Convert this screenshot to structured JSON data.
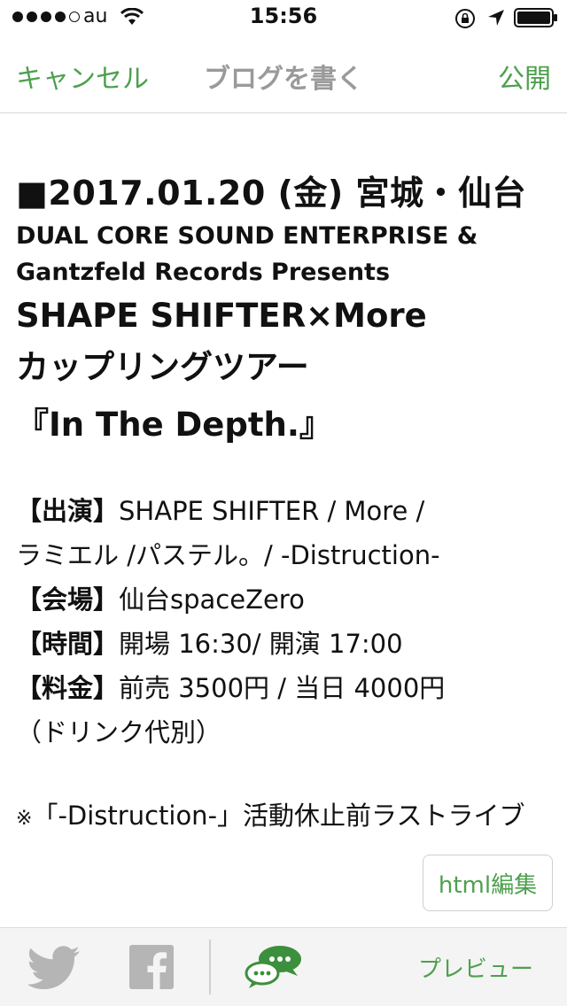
{
  "status_bar": {
    "carrier": "au",
    "time": "15:56"
  },
  "nav": {
    "cancel_label": "キャンセル",
    "title": "ブログを書く",
    "publish_label": "公開"
  },
  "post": {
    "title": "■2017.01.20 (金) 宮城・仙台",
    "presenter_line1": "DUAL CORE SOUND ENTERPRISE &",
    "presenter_line2": "Gantzfeld Records Presents",
    "heading_line1": "SHAPE SHIFTER×More",
    "heading_line2": "カップリングツアー",
    "tour_name": "『In The Depth.』",
    "details": [
      {
        "label": "【出演】",
        "value": "SHAPE SHIFTER / More /"
      },
      {
        "label": "",
        "value": "ラミエル /パステル。/ -Distruction-"
      },
      {
        "label": "【会場】",
        "value": "仙台spaceZero"
      },
      {
        "label": "【時間】",
        "value": "開場 16:30/ 開演 17:00"
      },
      {
        "label": "【料金】",
        "value": "前売 3500円 / 当日 4000円"
      },
      {
        "label": "",
        "value": "（ドリンク代別）"
      }
    ],
    "note_mark": "※",
    "note_text": "「-Distruction-」活動休止前ラストライブ"
  },
  "editor": {
    "html_edit_label": "html編集"
  },
  "toolbar": {
    "preview_label": "プレビュー"
  },
  "colors": {
    "accent": "#4ea04e",
    "nav_title": "#9a9a9a",
    "toolbar_bg": "#f4f4f4",
    "icon_gray": "#b5b5b5"
  }
}
